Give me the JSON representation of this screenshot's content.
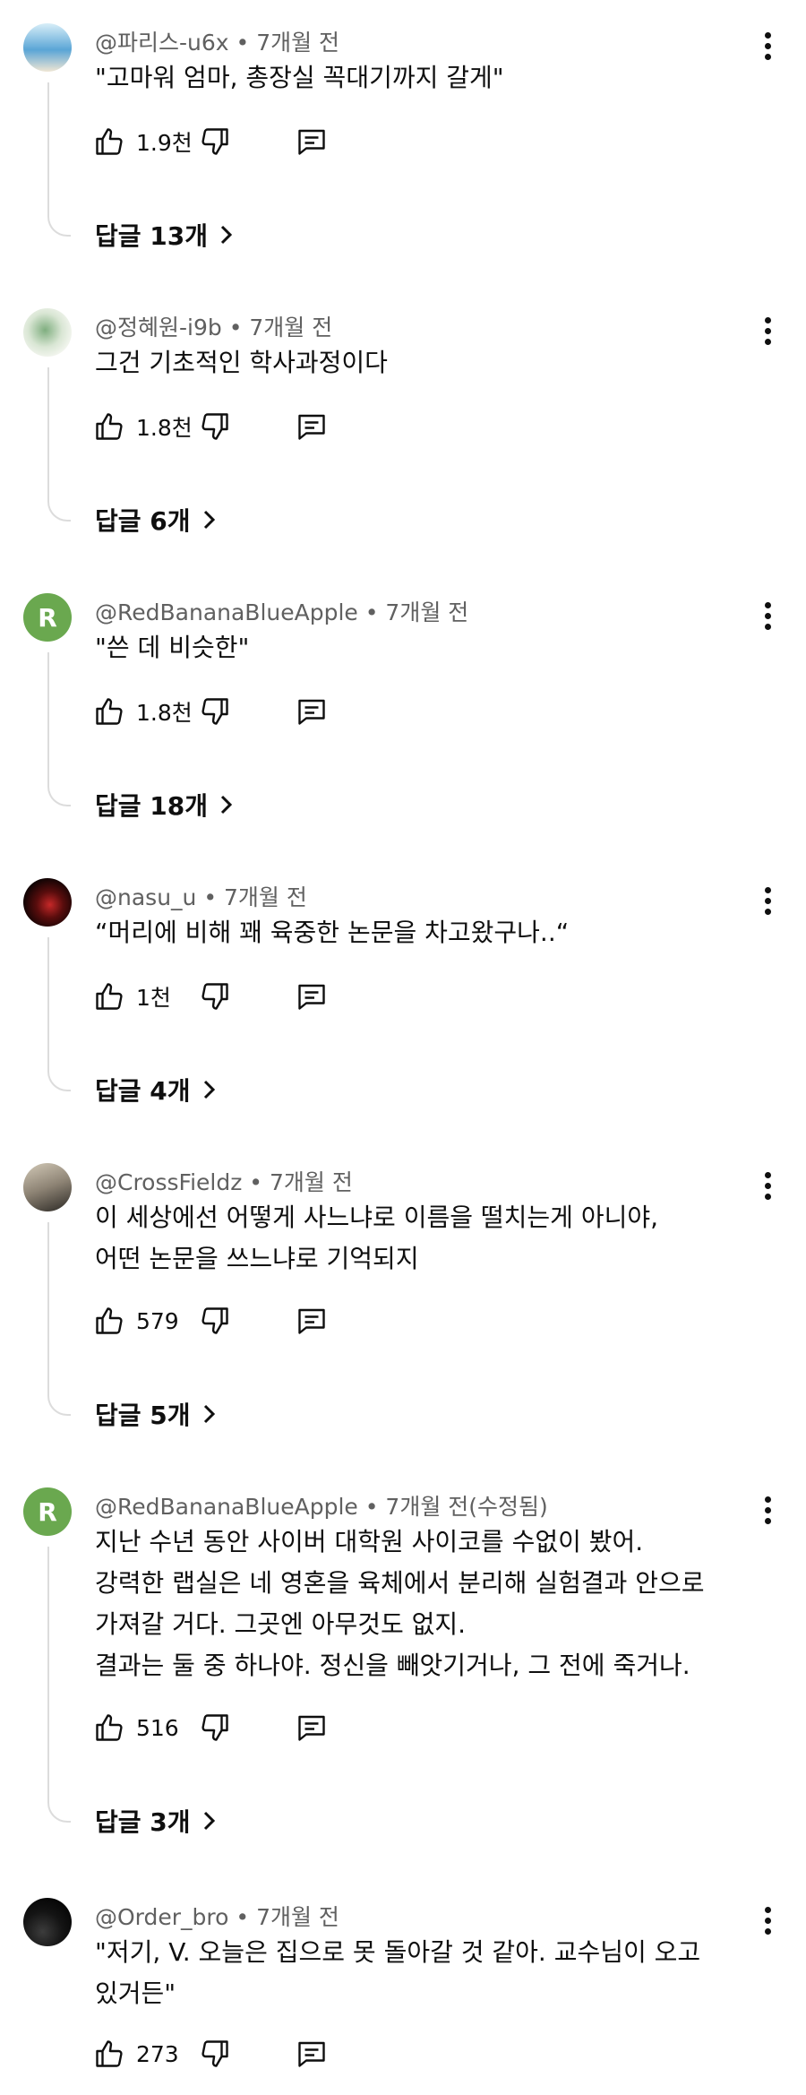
{
  "comments": [
    {
      "author": "@파리스-u6x",
      "meta": "@파리스-u6x • 7개월 전",
      "lines": [
        "\"고마워 엄마, 총장실 꼭대기까지 갈게\""
      ],
      "likes": "1.9천",
      "replies": "답글 13개",
      "avatar": {
        "type": "image",
        "colors": [
          "#cfe6f2",
          "#3f8fc4",
          "#e9e2d2"
        ]
      }
    },
    {
      "author": "@정혜원-i9b",
      "meta": "@정혜원-i9b • 7개월 전",
      "lines": [
        "그건 기초적인 학사과정이다"
      ],
      "likes": "1.8천",
      "replies": "답글 6개",
      "avatar": {
        "type": "image",
        "colors": [
          "#eef3ea",
          "#6c9c6e",
          "#c9d8c2"
        ]
      }
    },
    {
      "author": "@RedBananaBlueApple",
      "meta": "@RedBananaBlueApple • 7개월 전",
      "lines": [
        "\"쓴 데 비슷한\""
      ],
      "likes": "1.8천",
      "replies": "답글 18개",
      "avatar": {
        "type": "letter",
        "letter": "R",
        "color": "#6aa84f"
      }
    },
    {
      "author": "@nasu_u",
      "meta": "@nasu_u • 7개월 전",
      "lines": [
        "“머리에 비해 꽤 육중한 논문을 차고왔구나..“"
      ],
      "likes": "1천",
      "replies": "답글 4개",
      "avatar": {
        "type": "image",
        "colors": [
          "#1a0707",
          "#b32020",
          "#3a0b0b"
        ]
      }
    },
    {
      "author": "@CrossFieldz",
      "meta": "@CrossFieldz • 7개월 전",
      "lines": [
        "이 세상에선 어떻게 사느냐로 이름을 떨치는게 아니야,",
        "어떤 논문을 쓰느냐로 기억되지"
      ],
      "likes": "579",
      "replies": "답글 5개",
      "avatar": {
        "type": "image",
        "colors": [
          "#8e8578",
          "#2c2925",
          "#c9bfae"
        ]
      }
    },
    {
      "author": "@RedBananaBlueApple",
      "meta": "@RedBananaBlueApple • 7개월 전(수정됨)",
      "lines": [
        "지난 수년 동안 사이버 대학원 사이코를 수없이 봤어.",
        "강력한 랩실은 네 영혼을 육체에서 분리해 실험결과 안으로",
        "가져갈 거다. 그곳엔 아무것도 없지.",
        "결과는 둘 중 하나야. 정신을 빼앗기거나, 그 전에 죽거나."
      ],
      "likes": "516",
      "replies": "답글 3개",
      "avatar": {
        "type": "letter",
        "letter": "R",
        "color": "#6aa84f"
      }
    },
    {
      "author": "@Order_bro",
      "meta": "@Order_bro • 7개월 전",
      "lines": [
        "\"저기, V. 오늘은 집으로 못 돌아갈 것 같아. 교수님이 오고",
        "있거든\""
      ],
      "likes": "273",
      "replies": "",
      "avatar": {
        "type": "image",
        "colors": [
          "#0c0c0c",
          "#3a3a3a",
          "#1c1c1c"
        ]
      }
    }
  ],
  "icons": {
    "like": "thumb-up-icon",
    "dislike": "thumb-down-icon",
    "reply": "comment-reply-icon",
    "more": "more-vert-icon",
    "chevron": "chevron-right-icon"
  }
}
